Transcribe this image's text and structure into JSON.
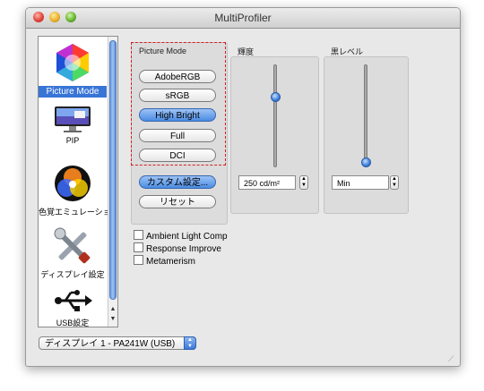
{
  "window": {
    "title": "MultiProfiler"
  },
  "sidebar": {
    "items": [
      {
        "label": "Picture Mode",
        "icon": "color-hexagon-icon",
        "selected": true
      },
      {
        "label": "PIP",
        "icon": "monitor-icon",
        "selected": false
      },
      {
        "label": "色覚エミュレーション",
        "icon": "color-vision-icon",
        "selected": false
      },
      {
        "label": "ディスプレイ設定",
        "icon": "tools-icon",
        "selected": false
      },
      {
        "label": "USB設定",
        "icon": "usb-icon",
        "selected": false
      }
    ]
  },
  "picture_mode": {
    "label": "Picture Mode",
    "modes": [
      "AdobeRGB",
      "sRGB",
      "High Bright",
      "Full",
      "DCI"
    ],
    "selected": "High Bright",
    "custom_button": "カスタム設定...",
    "reset_button": "リセット"
  },
  "brightness": {
    "label": "輝度",
    "value": "250 cd/m²",
    "level": 0.7
  },
  "black_level": {
    "label": "黒レベル",
    "value": "Min",
    "level": 0.0
  },
  "options": [
    {
      "label": "Ambient Light Comp",
      "checked": false
    },
    {
      "label": "Response Improve",
      "checked": false
    },
    {
      "label": "Metamerism",
      "checked": false
    }
  ],
  "display_select": {
    "value": "ディスプレイ 1 - PA241W (USB)"
  },
  "colors": {
    "selection": "#3875d7",
    "highlight_border": "#d42020",
    "active_button": "#4b8ce3"
  }
}
